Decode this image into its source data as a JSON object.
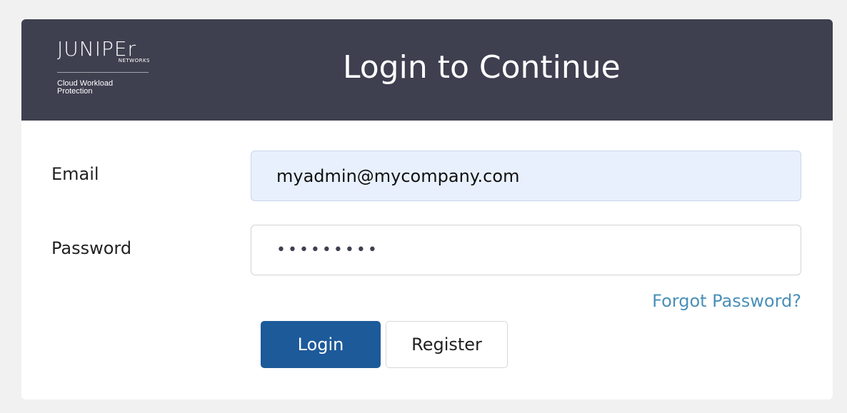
{
  "header": {
    "logo": {
      "wordmark": "JUNIPEr",
      "networks": "NETWORKS",
      "product": "Cloud Workload Protection"
    },
    "title": "Login to Continue"
  },
  "form": {
    "email_label": "Email",
    "email_value": "myadmin@mycompany.com",
    "password_label": "Password",
    "password_value": "•••••••••",
    "forgot_link": "Forgot Password?",
    "login_button": "Login",
    "register_button": "Register"
  },
  "colors": {
    "header_bg": "#3e4050",
    "primary_button": "#1d5a9a",
    "link": "#4a90b8",
    "autofill_bg": "#e8f0fd"
  }
}
